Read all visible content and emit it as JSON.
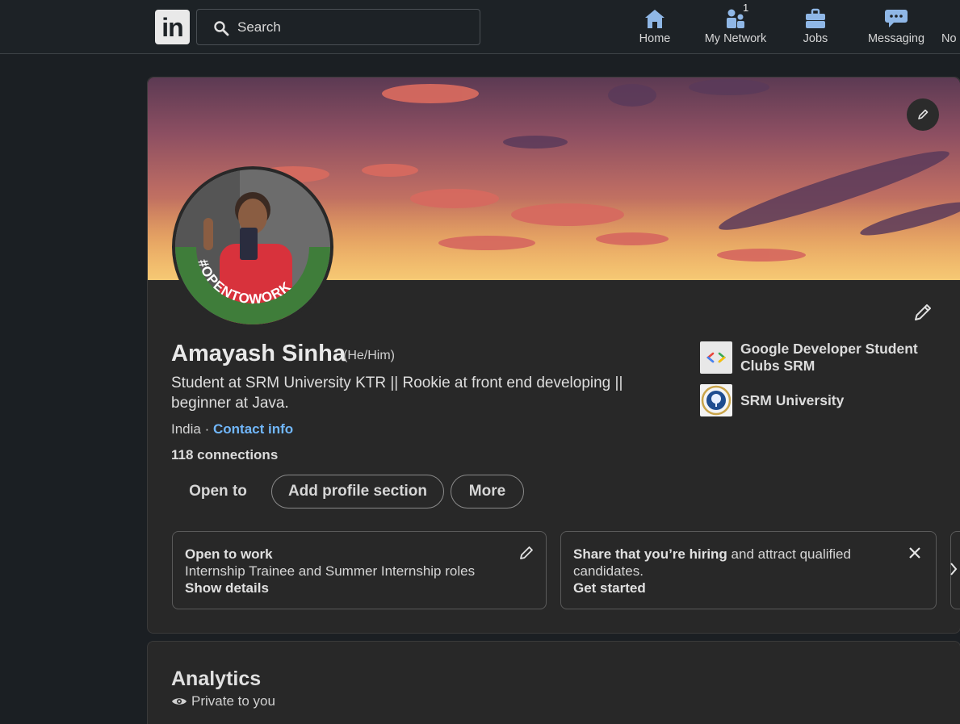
{
  "nav": {
    "logo_text": "in",
    "search_placeholder": "Search",
    "items": [
      {
        "label": "Home",
        "icon": "home-icon"
      },
      {
        "label": "My Network",
        "icon": "people-icon",
        "badge": "1"
      },
      {
        "label": "Jobs",
        "icon": "briefcase-icon"
      },
      {
        "label": "Messaging",
        "icon": "chat-icon"
      },
      {
        "label": "No",
        "icon": "bell-icon"
      }
    ]
  },
  "profile": {
    "avatar_badge_text": "#OPENTOWORK",
    "name": "Amayash Sinha",
    "pronouns": "(He/Him)",
    "headline": "Student at SRM University KTR || Rookie at front end developing || beginner at Java.",
    "location": "India",
    "location_separator": " · ",
    "contact_label": "Contact info",
    "connections": "118 connections",
    "actions": {
      "open_to": "Open to",
      "add_section": "Add profile section",
      "more": "More"
    },
    "organizations": [
      {
        "name": "Google Developer Student Clubs SRM",
        "logo": "gdsc-logo"
      },
      {
        "name": "SRM University",
        "logo": "srm-logo"
      }
    ],
    "open_to_work": {
      "title": "Open to work",
      "detail": "Internship Trainee and Summer Internship roles",
      "link": "Show details"
    },
    "hiring": {
      "bold": "Share that you’re hiring",
      "rest": " and attract qualified candidates.",
      "link": "Get started"
    }
  },
  "analytics": {
    "title": "Analytics",
    "subtitle": "Private to you"
  },
  "colors": {
    "accent_link": "#71b7fb",
    "card_bg": "#282828",
    "page_bg": "#1b1f23",
    "open_to_work_ring": "#3f7d3a"
  }
}
